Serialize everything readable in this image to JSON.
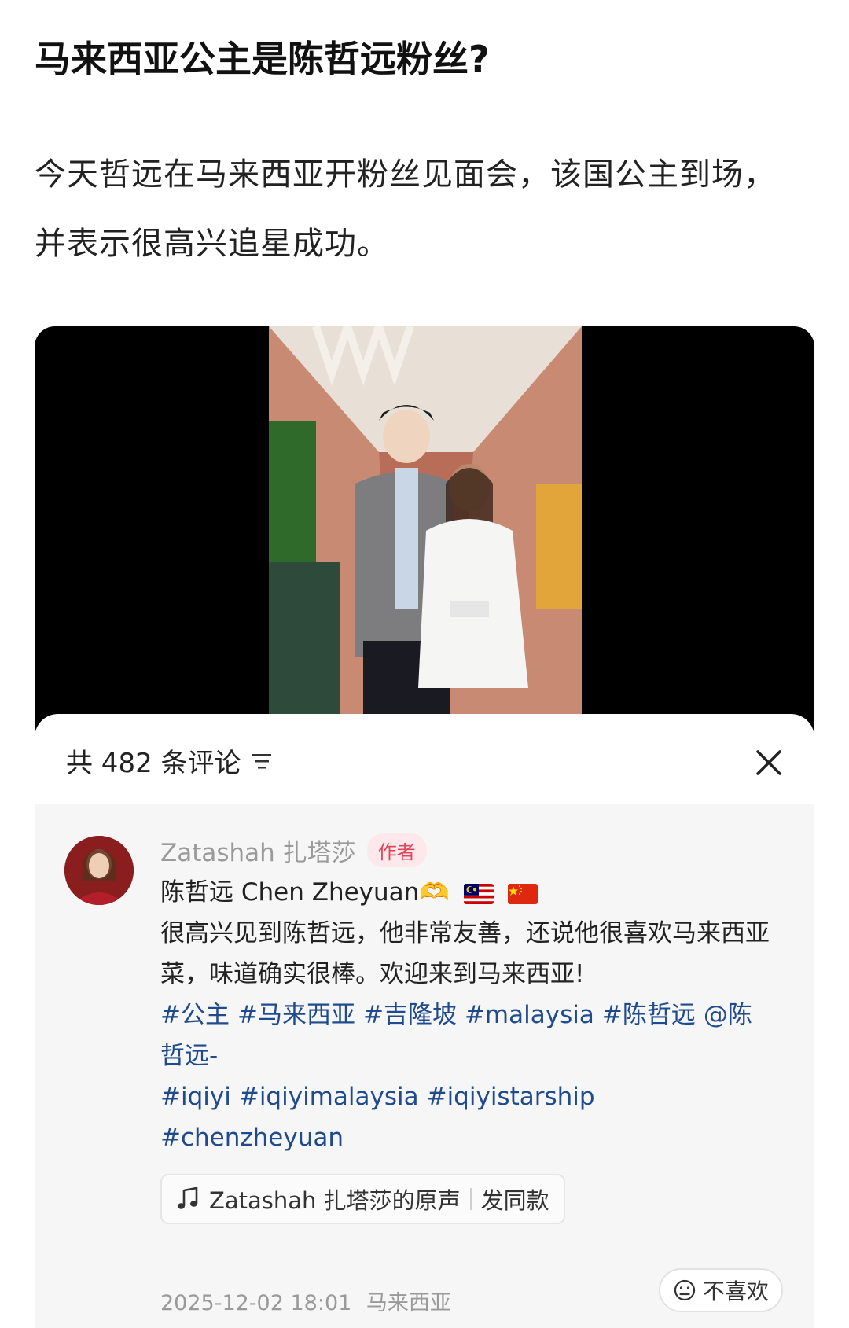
{
  "post": {
    "title": "马来西亚公主是陈哲远粉丝?",
    "body": "今天哲远在马来西亚开粉丝见面会，该国公主到场，并表示很高兴追星成功。"
  },
  "comments_sheet": {
    "count_label": "共 482 条评论",
    "filter_icon": "filter-icon",
    "close_icon": "close-icon"
  },
  "comment": {
    "author": "Zatashah 扎塔莎",
    "badge": "作者",
    "line1": "陈哲远 Chen Zheyuan🫶",
    "text": "很高兴见到陈哲远，他非常友善，还说他很喜欢马来西亚菜，味道确实很棒。欢迎来到马来西亚!",
    "hashtags_1": [
      "#公主",
      "#马来西亚",
      "#吉隆坡",
      "#malaysia",
      "#陈哲远",
      "@陈哲远-"
    ],
    "hashtags_2": [
      "#iqiyi",
      "#iqiyimalaysia",
      "#iqiyistarship"
    ],
    "hashtags_3": [
      "#chenzheyuan"
    ],
    "music_label": "Zatashah 扎塔莎的原声",
    "music_action": "发同款",
    "timestamp": "2025-12-02 18:01",
    "location": "马来西亚",
    "dislike_label": "不喜欢"
  },
  "colors": {
    "hashtag": "#1f4b8e",
    "badge_text": "#e0465a",
    "badge_bg": "#fde9ec"
  }
}
